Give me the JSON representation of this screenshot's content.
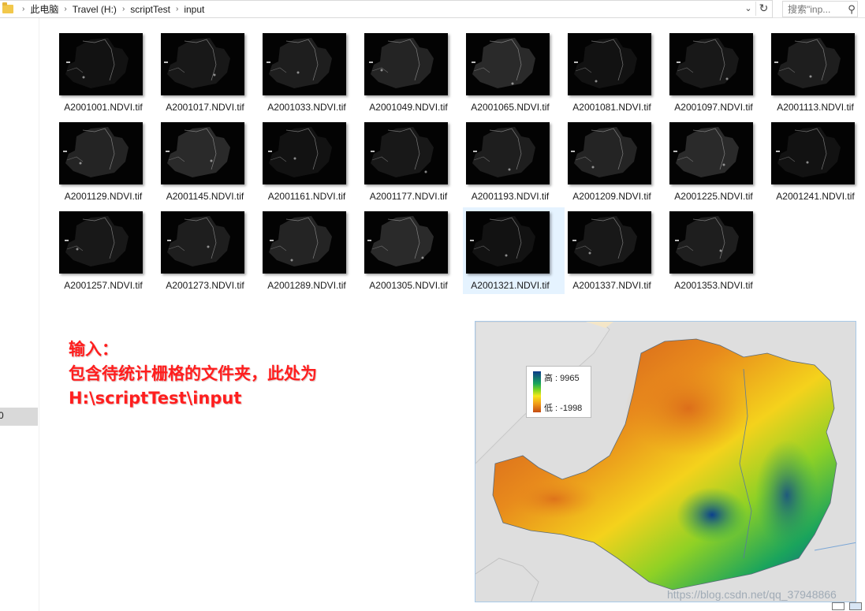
{
  "address_bar": {
    "crumbs": [
      "此电脑",
      "Travel (H:)",
      "scriptTest",
      "input"
    ]
  },
  "search": {
    "placeholder": "搜索\"inp..."
  },
  "nav": {
    "selected_text": "0"
  },
  "files": [
    "A2001001.NDVI.tif",
    "A2001017.NDVI.tif",
    "A2001033.NDVI.tif",
    "A2001049.NDVI.tif",
    "A2001065.NDVI.tif",
    "A2001081.NDVI.tif",
    "A2001097.NDVI.tif",
    "A2001113.NDVI.tif",
    "A2001129.NDVI.tif",
    "A2001145.NDVI.tif",
    "A2001161.NDVI.tif",
    "A2001177.NDVI.tif",
    "A2001193.NDVI.tif",
    "A2001209.NDVI.tif",
    "A2001225.NDVI.tif",
    "A2001241.NDVI.tif",
    "A2001257.NDVI.tif",
    "A2001273.NDVI.tif",
    "A2001289.NDVI.tif",
    "A2001305.NDVI.tif",
    "A2001321.NDVI.tif",
    "A2001337.NDVI.tif",
    "A2001353.NDVI.tif"
  ],
  "selected_file": "A2001321.NDVI.tif",
  "annotation": {
    "line1": "输入：",
    "line2": "包含待统计栅格的文件夹，此处为",
    "line3": "H:\\scriptTest\\input"
  },
  "legend": {
    "high": "高 : 9965",
    "low": "低 : -1998"
  },
  "watermark": "https://blog.csdn.net/qq_37948866",
  "colors": {
    "annotation": "#ff1e1e",
    "selection": "#e5f3ff",
    "legend_high": "#0a3a8a",
    "legend_low": "#c44a12"
  }
}
